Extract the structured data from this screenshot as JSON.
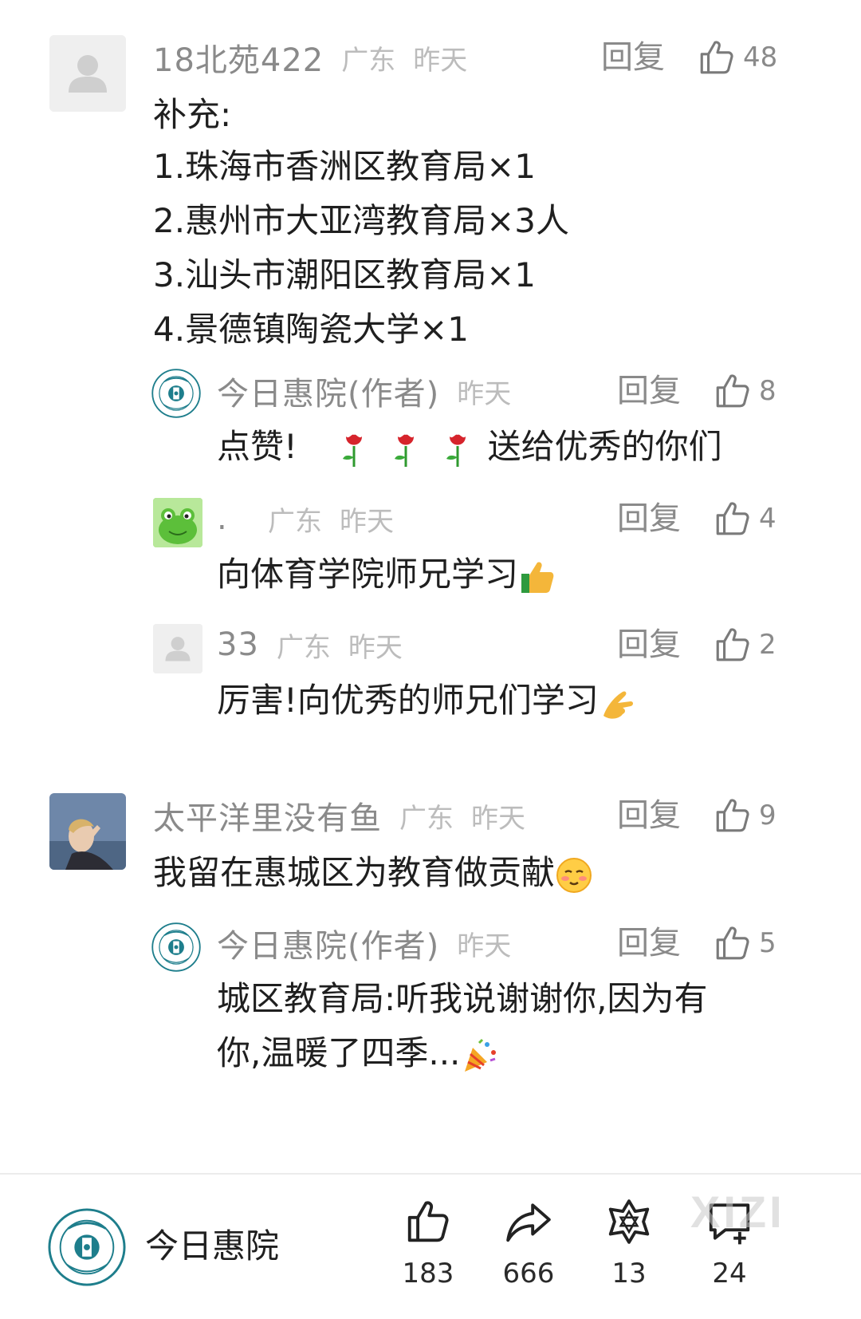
{
  "comments": [
    {
      "username": "18北苑422",
      "region": "广东",
      "time": "昨天",
      "reply_label": "回复",
      "likes": "48",
      "lines": [
        "补充:",
        "1.珠海市香洲区教育局×1",
        "2.惠州市大亚湾教育局×3人",
        "3.汕头市潮阳区教育局×1",
        "4.景德镇陶瓷大学×1"
      ],
      "replies": [
        {
          "username": "今日惠院(作者)",
          "time": "昨天",
          "reply_label": "回复",
          "likes": "8",
          "text_before": "点赞!",
          "emoji": "rose-emoji ×3",
          "text_after": "送给优秀的你们"
        },
        {
          "username": ".",
          "region": "广东",
          "time": "昨天",
          "reply_label": "回复",
          "likes": "4",
          "text": "向体育学院师兄学习",
          "emoji": "thumbs-up-emoji"
        },
        {
          "username": "33",
          "region": "广东",
          "time": "昨天",
          "reply_label": "回复",
          "likes": "2",
          "text": "厉害!向优秀的师兄们学习",
          "emoji": "pinched-fingers-emoji"
        }
      ]
    },
    {
      "username": "太平洋里没有鱼",
      "region": "广东",
      "time": "昨天",
      "reply_label": "回复",
      "likes": "9",
      "text": "我留在惠城区为教育做贡献",
      "emoji": "blushing-face-emoji",
      "replies": [
        {
          "username": "今日惠院(作者)",
          "time": "昨天",
          "reply_label": "回复",
          "likes": "5",
          "lines": [
            "城区教育局:听我说谢谢你,因为有",
            "你,温暖了四季..."
          ],
          "emoji": "party-popper-emoji"
        }
      ]
    }
  ],
  "bottom_bar": {
    "account_name": "今日惠院",
    "like_count": "183",
    "share_count": "666",
    "collect_count": "13",
    "comment_count": "24"
  },
  "watermark": "XIZI",
  "icons": {
    "like": "thumbs-up-outline-icon",
    "share": "share-arrow-icon",
    "collect": "star-outline-icon",
    "comment": "comment-add-icon"
  },
  "colors": {
    "meta_gray": "#8a8a8a",
    "light_gray": "#bcbcbc",
    "text": "#1f1f1f",
    "school_teal": "#1e7e8c"
  }
}
